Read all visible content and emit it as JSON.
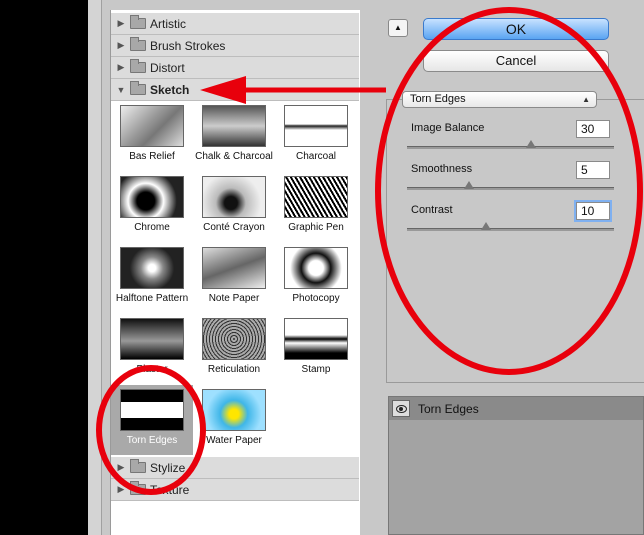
{
  "gallery": {
    "categories_top": [
      "Artistic",
      "Brush Strokes",
      "Distort"
    ],
    "open_category": "Sketch",
    "categories_bottom": [
      "Stylize",
      "Texture"
    ],
    "thumbnails": [
      "Bas Relief",
      "Chalk & Charcoal",
      "Charcoal",
      "Chrome",
      "Conté Crayon",
      "Graphic Pen",
      "Halftone Pattern",
      "Note Paper",
      "Photocopy",
      "Plaster",
      "Reticulation",
      "Stamp",
      "Torn Edges",
      "Water Paper"
    ],
    "selected": "Torn Edges"
  },
  "buttons": {
    "ok": "OK",
    "cancel": "Cancel",
    "collapse_icon": "triangle-up-icon"
  },
  "filter_select": "Torn Edges",
  "params": [
    {
      "label": "Image Balance",
      "value": "30",
      "slider_fraction": 0.6
    },
    {
      "label": "Smoothness",
      "value": "5",
      "slider_fraction": 0.3
    },
    {
      "label": "Contrast",
      "value": "10",
      "slider_fraction": 0.38
    }
  ],
  "layers": {
    "name": "Torn Edges"
  },
  "colors": {
    "annotation": "#e8000c",
    "ok_button": "#5aa4f2"
  }
}
